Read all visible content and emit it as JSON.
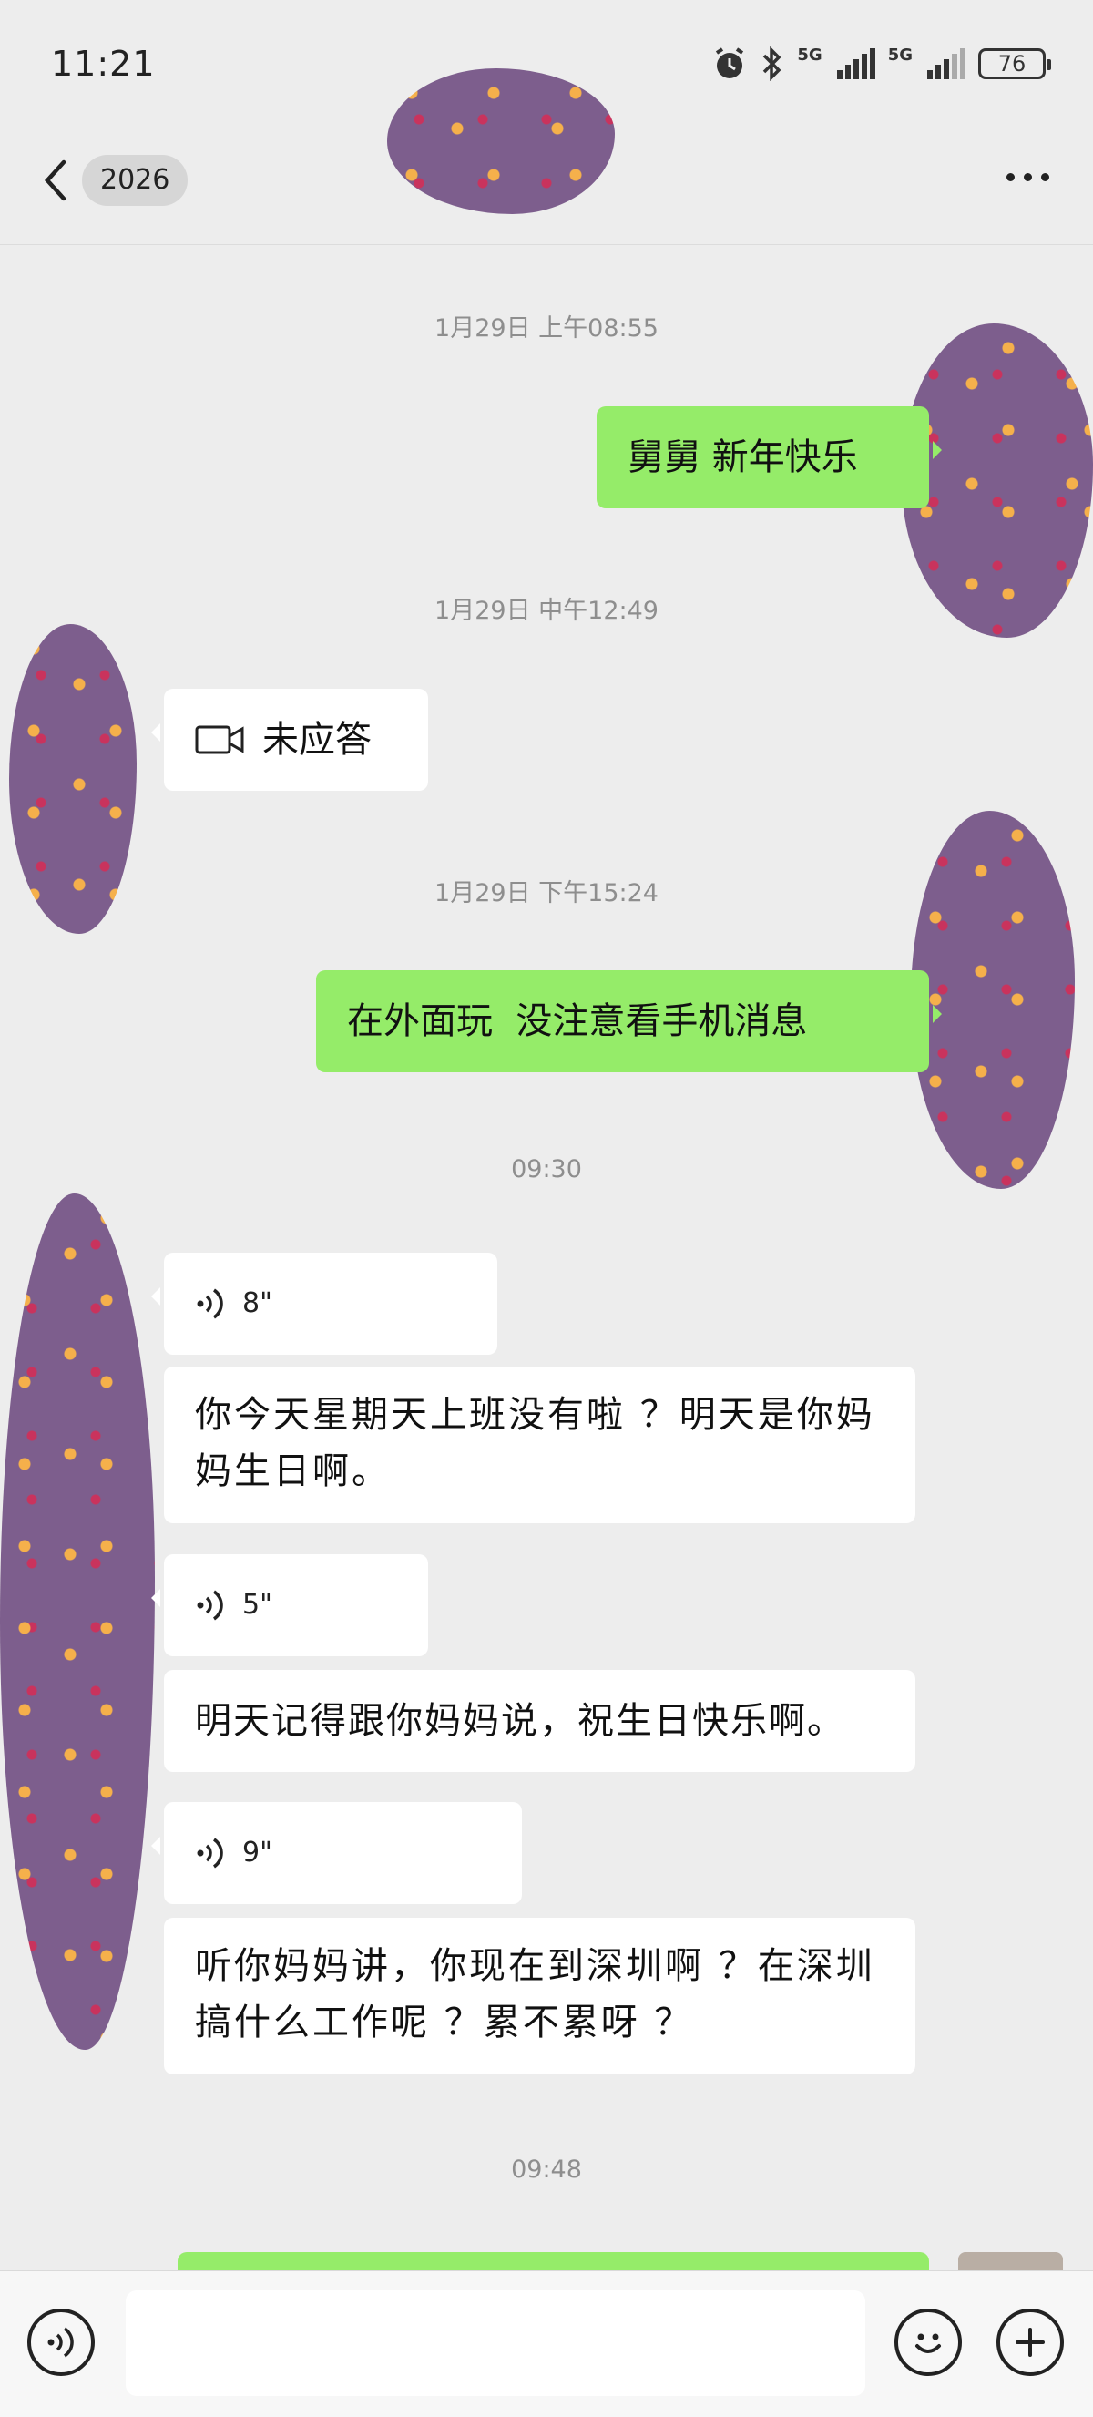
{
  "status_bar": {
    "time": "11:21",
    "network_1": "5G",
    "network_2": "5G",
    "battery": "76",
    "icons": [
      "alarm-icon",
      "bluetooth-icon",
      "signal-icon",
      "signal-icon",
      "battery-icon"
    ]
  },
  "header": {
    "back_label": "2026",
    "more_icon": "more-dots-icon"
  },
  "messages": [
    {
      "type": "timestamp",
      "text": "1月29日 上午08:55"
    },
    {
      "type": "text",
      "side": "right",
      "text": "舅舅 新年快乐"
    },
    {
      "type": "timestamp",
      "text": "1月29日 中午12:49"
    },
    {
      "type": "video_call",
      "side": "left",
      "text": "未应答"
    },
    {
      "type": "timestamp",
      "text": "1月29日 下午15:24"
    },
    {
      "type": "text",
      "side": "right",
      "text": "在外面玩  没注意看手机消息"
    },
    {
      "type": "timestamp",
      "text": "09:30"
    },
    {
      "type": "voice",
      "side": "left",
      "duration": "8\""
    },
    {
      "type": "text",
      "side": "left",
      "text": "你今天星期天上班没有啦 ？明天是你妈妈生日啊。"
    },
    {
      "type": "voice",
      "side": "left",
      "duration": "5\""
    },
    {
      "type": "text",
      "side": "left",
      "text": "明天记得跟你妈妈说，祝生日快乐啊。"
    },
    {
      "type": "voice",
      "side": "left",
      "duration": "9\""
    },
    {
      "type": "text",
      "side": "left",
      "text": "听你妈妈讲，你现在到深圳啊 ？在深圳搞什么工作呢 ？累不累呀 ？"
    },
    {
      "type": "timestamp",
      "text": "09:48"
    }
  ],
  "input_bar": {
    "value": "",
    "icons": [
      "voice-input-icon",
      "emoji-icon",
      "plus-icon"
    ]
  },
  "colors": {
    "background": "#ededed",
    "sent_bubble": "#95ec69",
    "received_bubble": "#ffffff",
    "mask": "#7d5e8d"
  }
}
